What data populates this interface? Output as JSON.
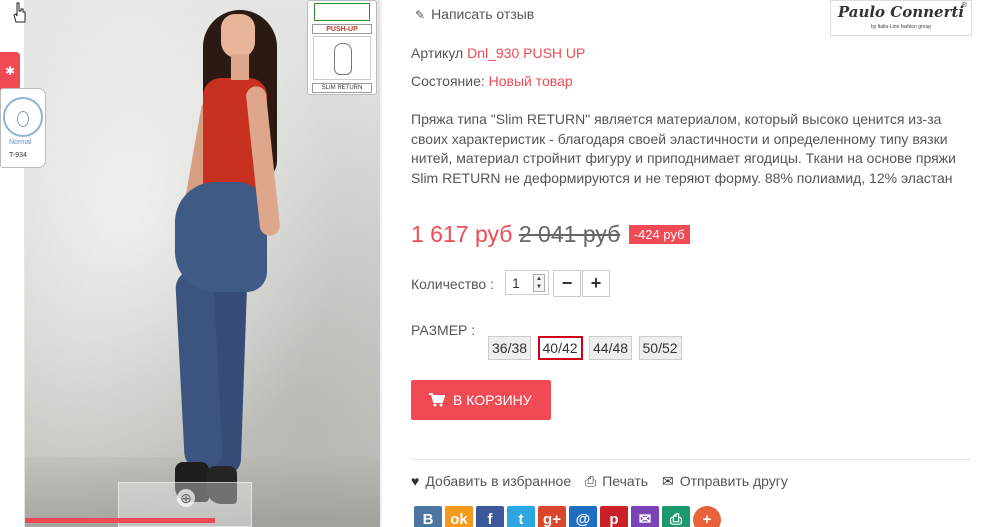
{
  "header": {
    "review_link": "Написать отзыв",
    "brand_name": "Paulo Connerti",
    "brand_sub": "by Italia-Line fashion group",
    "brand_reg": "®"
  },
  "left_badges": {
    "badge_normal": "Normal",
    "badge_model": "T-934",
    "tab_icon": "✱"
  },
  "label_card": {
    "push_up": "PUSH-UP",
    "slim_return": "SLIM RETURN"
  },
  "product": {
    "article_label": "Артикул",
    "article_value": "Dnl_930 PUSH UP",
    "condition_label": "Состояние:",
    "condition_value": "Новый товар",
    "description": "Пряжа типа \"Slim RETURN\" является материалом, который высоко ценится из-за своих характеристик - благодаря своей эластичности и определенному типу вязки нитей, материал стройнит фигуру и приподнимает ягодицы. Ткани на основе пряжи Slim RETURN не деформируются и не теряют форму. 88% полиамид, 12% эластан",
    "price": "1 617 руб",
    "old_price": "2 041 руб",
    "discount": "-424 руб"
  },
  "quantity": {
    "label": "Количество :",
    "value": "1",
    "minus": "−",
    "plus": "+"
  },
  "size": {
    "label": "РАЗМЕР :",
    "options": [
      "36/38",
      "40/42",
      "44/48",
      "50/52"
    ],
    "selected": "40/42"
  },
  "cart": {
    "button_label": "В КОРЗИНУ"
  },
  "actions": {
    "favorite": "Добавить в избранное",
    "print": "Печать",
    "send": "Отправить другу"
  },
  "social": [
    {
      "icon": "vk-icon",
      "glyph": "В",
      "color": "#4c75a3"
    },
    {
      "icon": "odnoklassniki-icon",
      "glyph": "ok",
      "color": "#f59a1c"
    },
    {
      "icon": "facebook-icon",
      "glyph": "f",
      "color": "#3b5998"
    },
    {
      "icon": "twitter-icon",
      "glyph": "t",
      "color": "#2ca7e0"
    },
    {
      "icon": "googleplus-icon",
      "glyph": "g+",
      "color": "#d9472c"
    },
    {
      "icon": "mail-icon",
      "glyph": "@",
      "color": "#1e6fc1"
    },
    {
      "icon": "pinterest-icon",
      "glyph": "p",
      "color": "#cb2027"
    },
    {
      "icon": "email-icon",
      "glyph": "✉",
      "color": "#7b43b5"
    },
    {
      "icon": "print-icon",
      "glyph": "⎙",
      "color": "#1c9a6c"
    },
    {
      "icon": "more-icon",
      "glyph": "+",
      "color": "#e8633a"
    }
  ],
  "colors": {
    "accent": "#f04b55",
    "selected_size_border": "#d0021b"
  }
}
